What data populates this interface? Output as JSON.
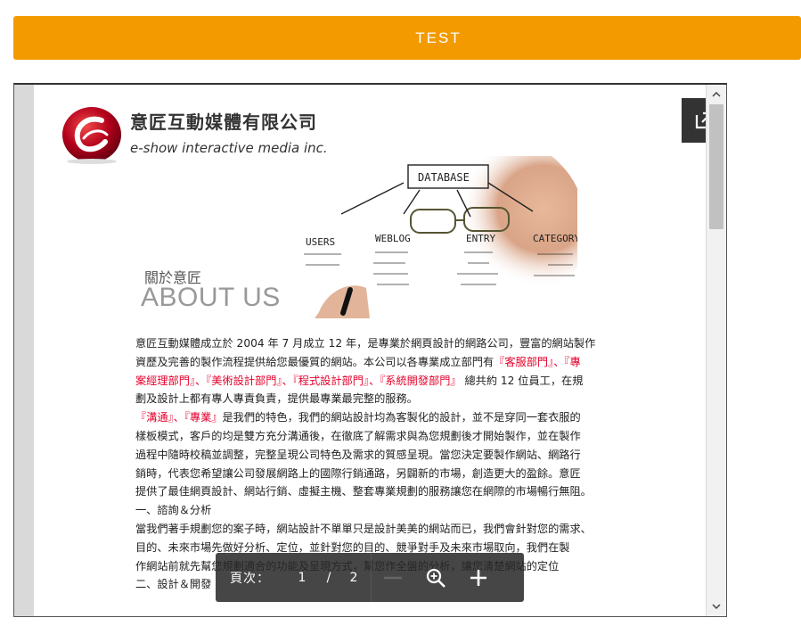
{
  "header": {
    "title": "TEST",
    "bar_color": "#f39a00"
  },
  "document": {
    "company_name": "意匠互動媒體有限公司",
    "company_english": "e-show interactive media inc.",
    "about_cn": "關於意匠",
    "about_en": "ABOUT US",
    "highlight_color": "#e4002b",
    "hero_sketch": {
      "database": "DATABASE",
      "users": "USERS",
      "weblog": "WEBLOG",
      "entry": "ENTRY",
      "category": "CATEGORY"
    },
    "paragraphs": [
      [
        {
          "t": "意匠互動媒體成立於 2004 年 7 月成立 12 年，是專業於網頁設計的網路公司，豐富的網站製作"
        }
      ],
      [
        {
          "t": "資歷及完善的製作流程提供給您最優質的網站。本公司以各專業成立部門有"
        },
        {
          "t": "『客服部門』、『專",
          "hl": true
        }
      ],
      [
        {
          "t": "案經理部門』、『美術設計部門』、『程式設計部門』、『系統開發部門』",
          "hl": true
        },
        {
          "t": " 總共約 12 位員工，在規"
        }
      ],
      [
        {
          "t": "劃及設計上都有專人專責負責，提供最專業最完整的服務。"
        }
      ],
      [
        {
          "t": "『溝通』、『專業』",
          "hl": true
        },
        {
          "t": "是我們的特色，我們的網站設計均為客製化的設計，並不是穿同一套衣服的"
        }
      ],
      [
        {
          "t": "樣板模式，客戶的均是雙方充分溝通後，在徹底了解需求與為您規劃後才開始製作，並在製作"
        }
      ],
      [
        {
          "t": "過程中隨時校稿並調整，完整呈現公司特色及需求的質感呈現。當您決定要製作網站、網路行"
        }
      ],
      [
        {
          "t": "銷時，代表您希望讓公司發展網路上的國際行銷通路，另闢新的市場，創造更大的盈餘。意匠"
        }
      ],
      [
        {
          "t": "提供了最佳網頁設計、網站行銷、虛擬主機、整套專業規劃的服務讓您在網際的市場暢行無阻。"
        }
      ],
      [
        {
          "t": "一、諮詢＆分析"
        }
      ],
      [
        {
          "t": "當我們著手規劃您的案子時，網站設計不單單只是設計美美的網站而已，我們會針對您的需求、"
        }
      ],
      [
        {
          "t": "目的、未來市場先做好分析、定位，並針對您的目的、競爭對手及未來市場取向，我們在製"
        }
      ],
      [
        {
          "t": "作網站前就先幫您規劃適合的功能及呈現方式，幫您作全盤的分析，讓您清楚網站的定位"
        }
      ],
      [
        {
          "t": "二、設計＆開發"
        }
      ]
    ]
  },
  "toolbar": {
    "page_label": "頁次：",
    "current_page": "1",
    "separator": "/",
    "total_pages": "2"
  },
  "icons": {
    "popout": "popout-icon",
    "zoom_out": "zoom-out-icon",
    "zoom_in": "zoom-in-icon",
    "add": "plus-icon",
    "scroll_up": "chevron-up-icon",
    "scroll_down": "chevron-down-icon"
  }
}
